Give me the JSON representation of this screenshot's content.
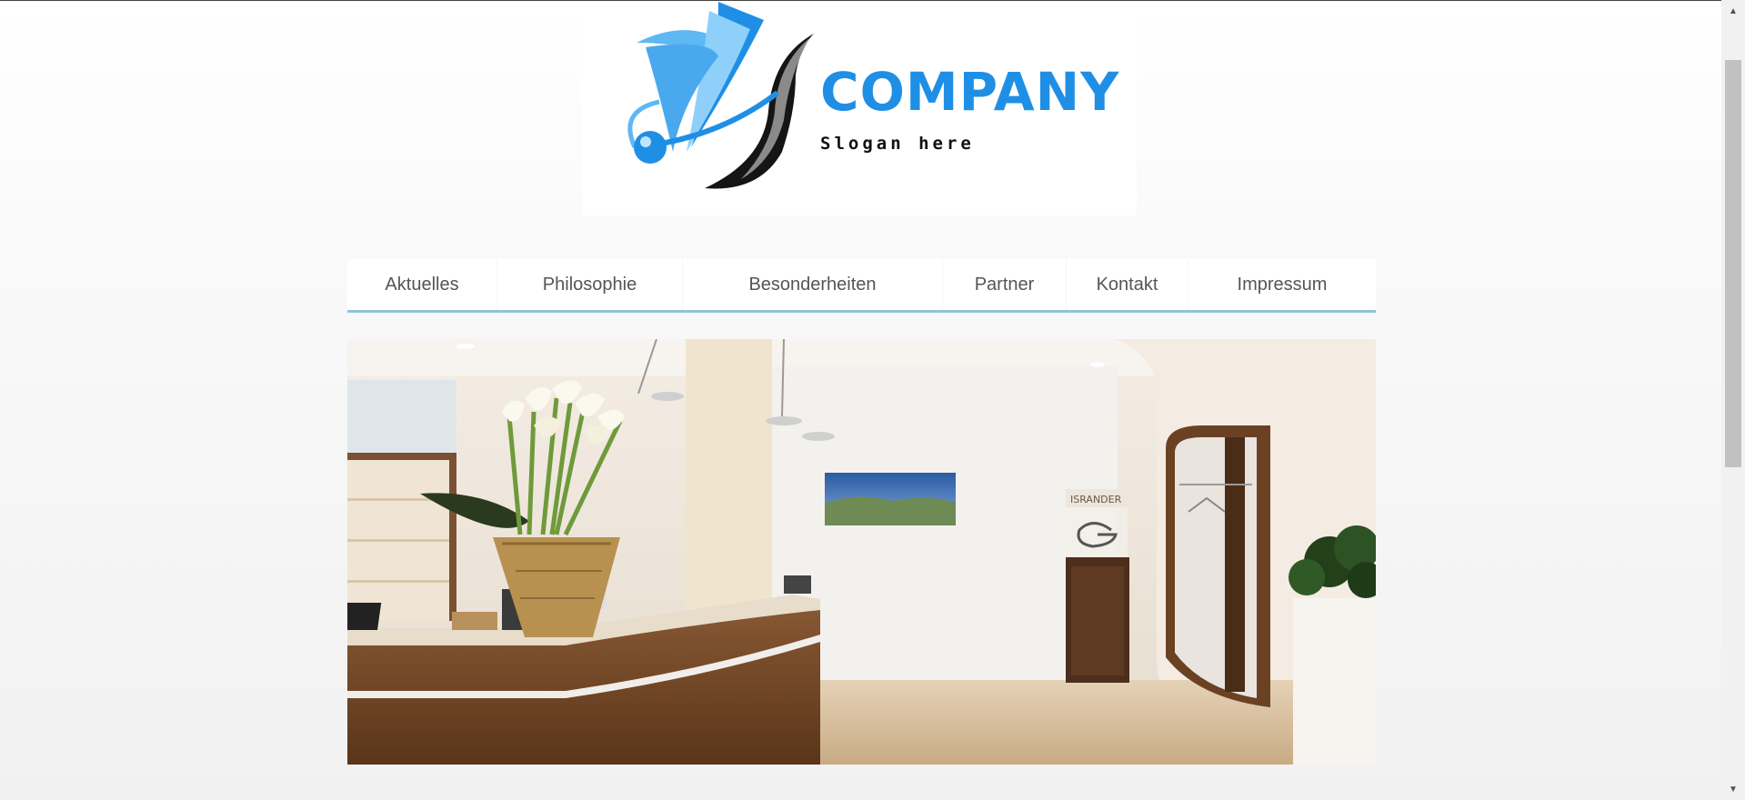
{
  "logo": {
    "name": "COMPANY",
    "slogan": "Slogan here",
    "colors": {
      "primary_blue": "#1f8fe6",
      "light_blue": "#5db8f4",
      "dark": "#111111"
    }
  },
  "nav": {
    "items": [
      {
        "label": "Aktuelles"
      },
      {
        "label": "Philosophie"
      },
      {
        "label": "Besonderheiten"
      },
      {
        "label": "Partner"
      },
      {
        "label": "Kontakt"
      },
      {
        "label": "Impressum"
      }
    ],
    "underline_color": "#8ec3d8"
  },
  "hero": {
    "sign_text": "ISRANDER"
  },
  "scrollbar": {
    "up_icon": "▲",
    "down_icon": "▼"
  }
}
